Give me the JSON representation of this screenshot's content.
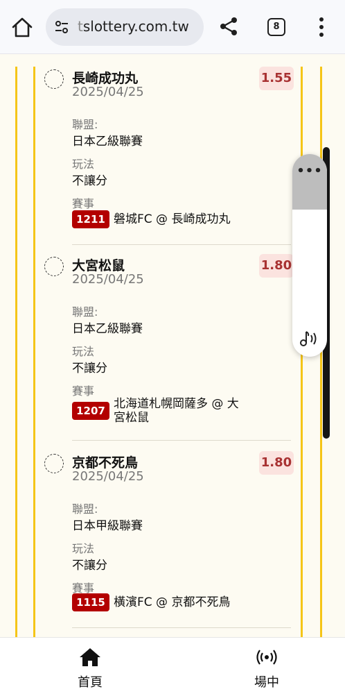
{
  "browser": {
    "url_prefix": "t",
    "url_main": "slottery.com.tw",
    "tab_count": "8"
  },
  "bets": [
    {
      "team": "長崎成功丸",
      "date": "2025/04/25",
      "odds": "1.55",
      "league_label": "聯盟:",
      "league": "日本乙級聯賽",
      "play_label": "玩法",
      "play": "不讓分",
      "event_label": "賽事",
      "match_no": "1211",
      "match": "磐城FC @ 長崎成功丸"
    },
    {
      "team": "大宮松鼠",
      "date": "2025/04/25",
      "odds": "1.80",
      "league_label": "聯盟:",
      "league": "日本乙級聯賽",
      "play_label": "玩法",
      "play": "不讓分",
      "event_label": "賽事",
      "match_no": "1207",
      "match": "北海道札幌岡薩多 @ 大宮松鼠"
    },
    {
      "team": "京都不死鳥",
      "date": "2025/04/25",
      "odds": "1.80",
      "league_label": "聯盟:",
      "league": "日本甲級聯賽",
      "play_label": "玩法",
      "play": "不讓分",
      "event_label": "賽事",
      "match_no": "1115",
      "match": "橫濱FC @ 京都不死鳥"
    }
  ],
  "volume_widget": {
    "menu_glyph": "•••",
    "icon": "music-note-volume-icon"
  },
  "bottom_nav": {
    "home_label": "首頁",
    "live_label": "場中",
    "home_icon": "home-icon",
    "live_icon": "broadcast-icon"
  },
  "colors": {
    "rail": "#f5c518",
    "odds_bg": "#fbe3df",
    "odds_text": "#a83232",
    "match_badge": "#b30000"
  }
}
